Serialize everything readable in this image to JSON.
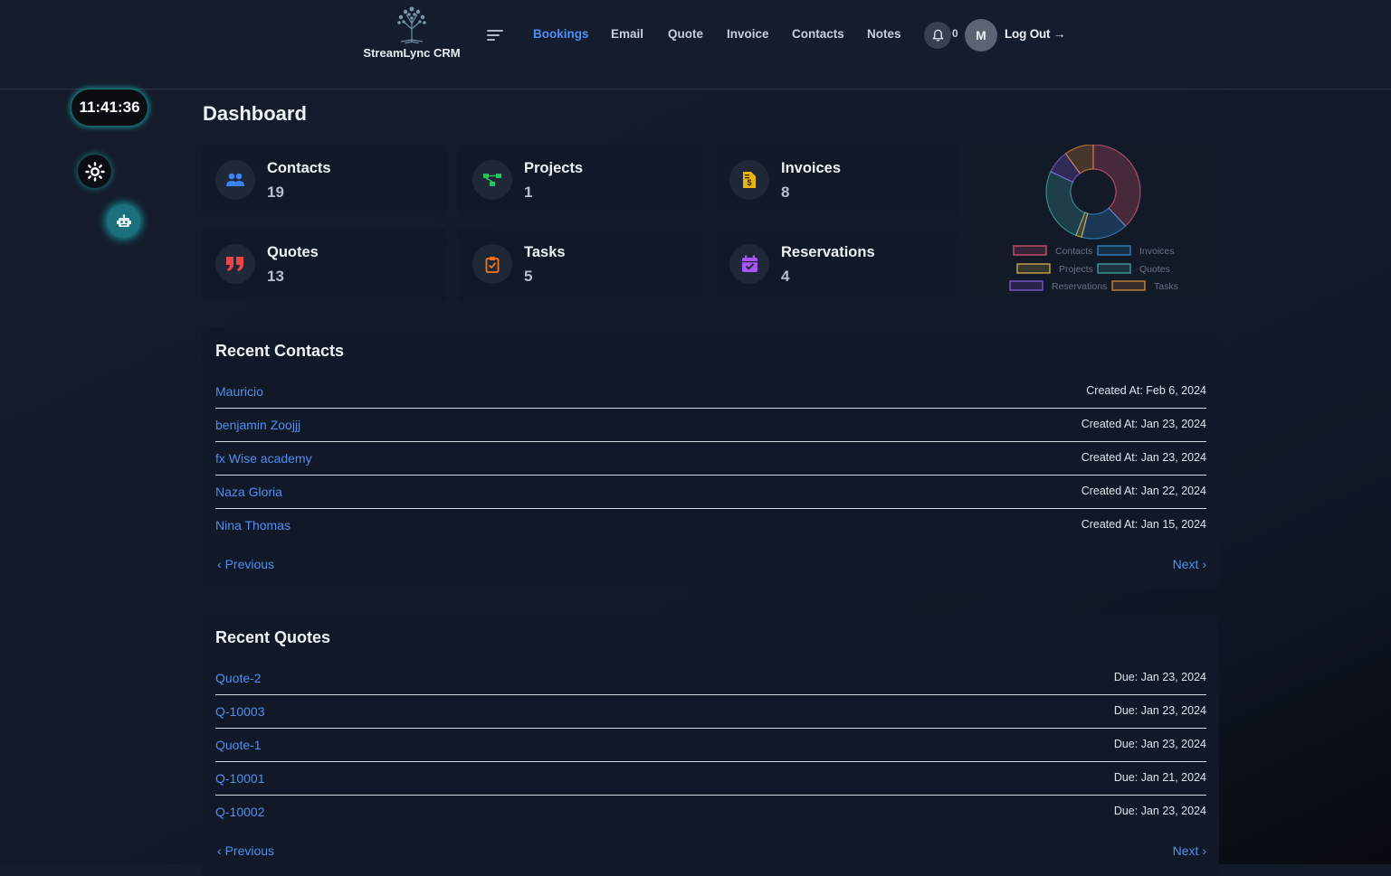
{
  "header": {
    "brand_name": "StreamLync CRM",
    "nav": [
      {
        "label": "Bookings",
        "active": true
      },
      {
        "label": "Email"
      },
      {
        "label": "Quote"
      },
      {
        "label": "Invoice"
      },
      {
        "label": "Contacts"
      },
      {
        "label": "Notes"
      }
    ],
    "notification_count": "0",
    "avatar_initial": "M",
    "logout_label": "Log Out →"
  },
  "sidebar": {
    "clock": "11:41:36",
    "theme_icon": "sun-icon",
    "assistant_icon": "robot-icon"
  },
  "dashboard": {
    "title": "Dashboard",
    "cards": [
      {
        "label": "Contacts",
        "value": "19",
        "icon": "users-icon",
        "color": "#3b82f6"
      },
      {
        "label": "Projects",
        "value": "1",
        "icon": "project-diagram-icon",
        "color": "#22c55e"
      },
      {
        "label": "Invoices",
        "value": "8",
        "icon": "invoice-dollar-icon",
        "color": "#eab308"
      },
      {
        "label": "Quotes",
        "value": "13",
        "icon": "quote-icon",
        "color": "#ef4444"
      },
      {
        "label": "Tasks",
        "value": "5",
        "icon": "clipboard-check-icon",
        "color": "#f97316"
      },
      {
        "label": "Reservations",
        "value": "4",
        "icon": "calendar-check-icon",
        "color": "#a855f7"
      }
    ]
  },
  "chart_data": {
    "type": "pie",
    "categories": [
      "Contacts",
      "Invoices",
      "Projects",
      "Quotes",
      "Reservations",
      "Tasks"
    ],
    "values": [
      19,
      8,
      1,
      13,
      4,
      5
    ],
    "colors": [
      "#ff6384",
      "#36a2eb",
      "#ffce56",
      "#4bc0c0",
      "#9966ff",
      "#ff9f40"
    ],
    "legend": "bottom"
  },
  "recent_contacts": {
    "title": "Recent Contacts",
    "items": [
      {
        "name": "Mauricio",
        "date": "Created At: Feb 6, 2024"
      },
      {
        "name": "benjamin Zoojjj",
        "date": "Created At: Jan 23, 2024"
      },
      {
        "name": "fx Wise academy",
        "date": "Created At: Jan 23, 2024"
      },
      {
        "name": "Naza Gloria",
        "date": "Created At: Jan 22, 2024"
      },
      {
        "name": "Nina Thomas",
        "date": "Created At: Jan 15, 2024"
      }
    ],
    "prev_label": "Previous",
    "next_label": "Next"
  },
  "recent_quotes": {
    "title": "Recent Quotes",
    "items": [
      {
        "name": "Quote-2",
        "date": "Due: Jan 23, 2024"
      },
      {
        "name": "Q-10003",
        "date": "Due: Jan 23, 2024"
      },
      {
        "name": "Quote-1",
        "date": "Due: Jan 23, 2024"
      },
      {
        "name": "Q-10001",
        "date": "Due: Jan 21, 2024"
      },
      {
        "name": "Q-10002",
        "date": "Due: Jan 23, 2024"
      }
    ],
    "prev_label": "Previous",
    "next_label": "Next"
  }
}
